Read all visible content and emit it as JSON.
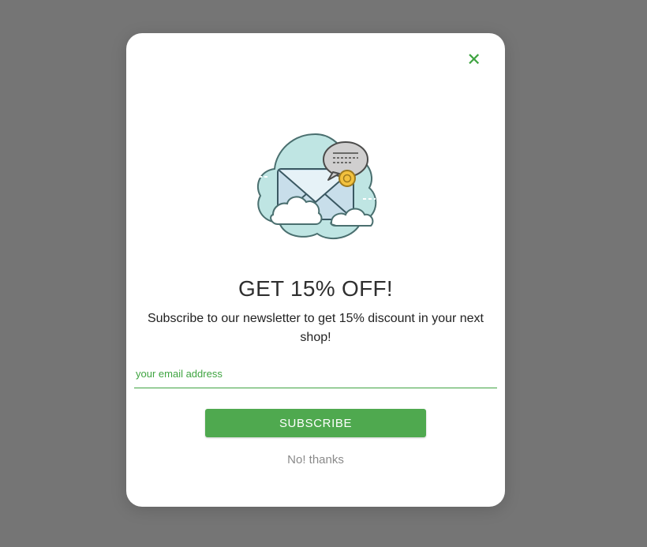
{
  "modal": {
    "title": "GET 15% OFF!",
    "subtitle": "Subscribe to our newsletter to get 15% discount in your next shop!",
    "email_placeholder": "your email address",
    "subscribe_label": "SUBSCRIBE",
    "decline_label": "No! thanks"
  }
}
